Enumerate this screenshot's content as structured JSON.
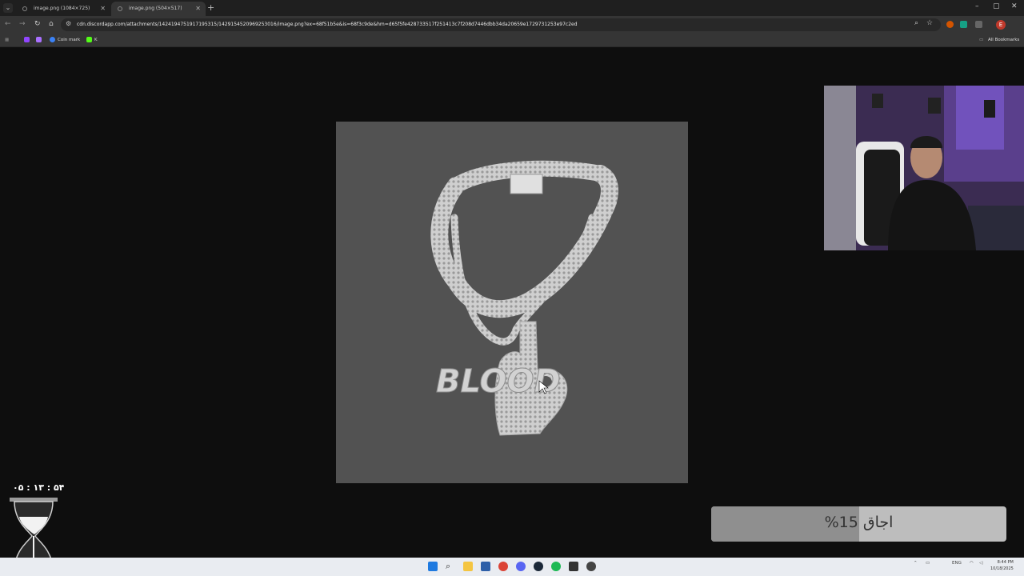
{
  "browser": {
    "tabs": [
      {
        "label": "image.png (1084×725)",
        "active": false
      },
      {
        "label": "image.png (504×517)",
        "active": true
      }
    ],
    "new_tab": "+",
    "tab_close": "✕",
    "window_controls": {
      "minimize": "–",
      "maximize": "▢",
      "close": "✕"
    },
    "address": "cdn.discordapp.com/attachments/1424194751917195315/1429154520969253016/image.png?ex=68f51b5e&is=68f3c9de&hm=d65f5fe428733517f251413c7f208d7446dbb34da20659e1729731253e97c2ed",
    "profile_initial": "E",
    "bookmarks": [
      {
        "label": "",
        "icon": "twitch-icon"
      },
      {
        "label": "",
        "icon": "heart-shield-icon"
      },
      {
        "label": "Coin mark",
        "icon": "coin-icon"
      },
      {
        "label": "K",
        "icon": "kick-icon"
      }
    ],
    "all_bookmarks": "All Bookmarks"
  },
  "overlay": {
    "timer": "۰۵ : ۱۳ : ۵۴",
    "progress": {
      "label": "اجاق",
      "percent_text": "15%",
      "value": 0.5
    },
    "icons": [
      "hourglass-icon",
      "webcam-feed"
    ]
  },
  "image": {
    "description_icon": "chain-pendant-image",
    "text_on_pendant": "BLOOD"
  },
  "taskbar": {
    "apps": [
      "windows-start-icon",
      "search-icon",
      "file-explorer-icon",
      "vscode-like-icon",
      "chrome-icon",
      "discord-icon",
      "steam-icon",
      "spotify-icon",
      "terminal-icon",
      "record-icon"
    ],
    "lang": "ENG",
    "time": "8:44 PM",
    "date": "10/18/2025"
  },
  "colors": {
    "page_bg": "#0e0e0e",
    "viewer_bg": "#525252",
    "progress_bg": "#bdbdbd",
    "progress_fill": "#8f8f8f"
  }
}
